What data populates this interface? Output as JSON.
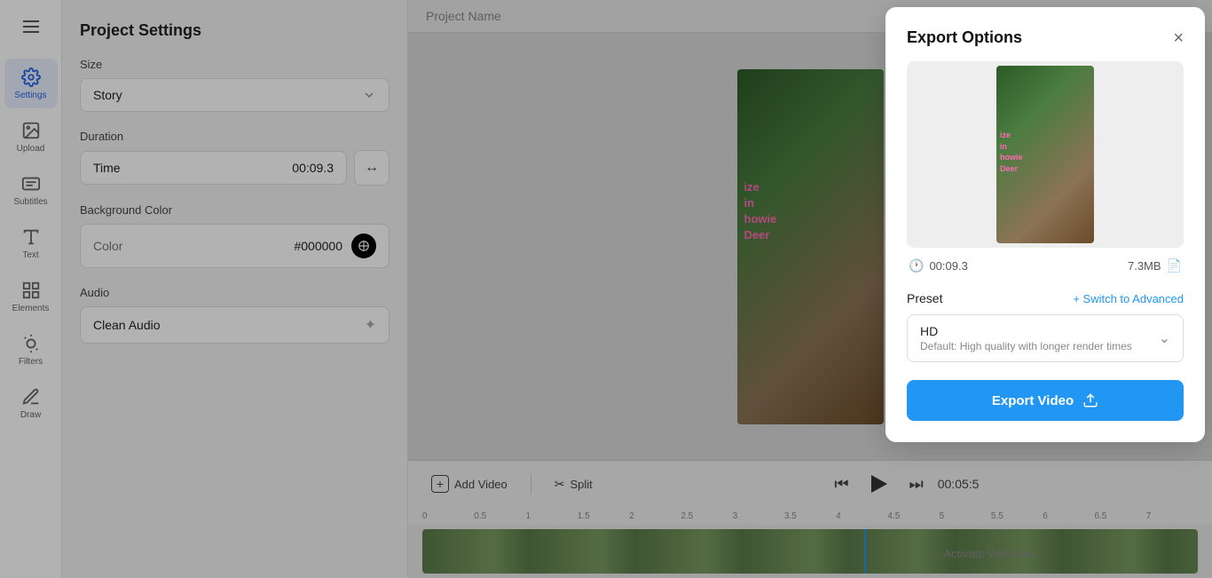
{
  "sidebar": {
    "hamburger_label": "Menu",
    "items": [
      {
        "id": "settings",
        "label": "Settings",
        "active": true
      },
      {
        "id": "upload",
        "label": "Upload",
        "active": false
      },
      {
        "id": "subtitles",
        "label": "Subtitles",
        "active": false
      },
      {
        "id": "text",
        "label": "Text",
        "active": false
      },
      {
        "id": "elements",
        "label": "Elements",
        "active": false
      },
      {
        "id": "filters",
        "label": "Filters",
        "active": false
      },
      {
        "id": "draw",
        "label": "Draw",
        "active": false
      }
    ]
  },
  "panel": {
    "title": "Project Settings",
    "size": {
      "label": "Size",
      "value": "Story",
      "placeholder": "Story"
    },
    "duration": {
      "label": "Duration",
      "input_label": "Time",
      "value": "00:09.3"
    },
    "background_color": {
      "label": "Background Color",
      "field_label": "Color",
      "hex": "#000000"
    },
    "audio": {
      "label": "Audio",
      "value": "Clean Audio"
    }
  },
  "canvas": {
    "project_name": "Project Name",
    "video_overlay_lines": [
      "ize",
      "in",
      "howie",
      "Deer"
    ]
  },
  "timeline": {
    "add_video_label": "Add Video",
    "split_label": "Split",
    "time_display": "00:05:5",
    "ruler_marks": [
      "0",
      "0.5",
      "1",
      "1.5",
      "2",
      "2.5",
      "3",
      "3.5",
      "4",
      "4.5",
      "5",
      "5.5",
      "6",
      "6.5",
      "7"
    ]
  },
  "export_modal": {
    "title": "Export Options",
    "close_label": "×",
    "duration": "00:09.3",
    "file_size": "7.3MB",
    "preset_label": "Preset",
    "switch_advanced_label": "+ Switch to Advanced",
    "preset_name": "HD",
    "preset_description": "Default: High quality with longer render times",
    "export_button_label": "Export Video",
    "activate_windows_text": "Activate Windows"
  }
}
